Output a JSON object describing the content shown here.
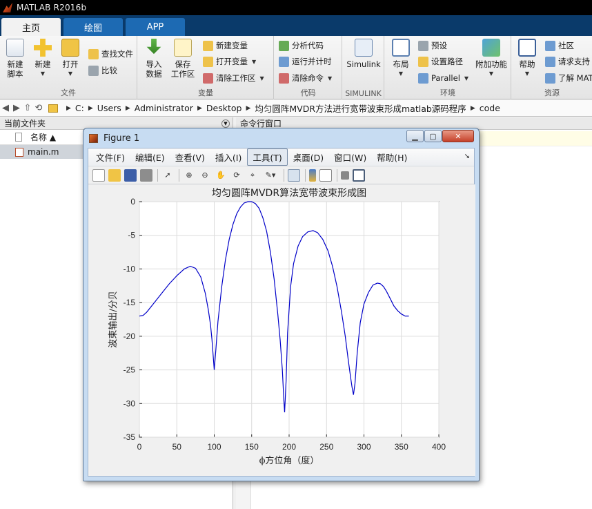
{
  "app": {
    "title": "MATLAB R2016b"
  },
  "ribbon_tabs": [
    "主页",
    "绘图",
    "APP"
  ],
  "ribbon": {
    "file": {
      "label": "文件",
      "new_script": "新建\n脚本",
      "new": "新建",
      "open": "打开",
      "find_files": "查找文件",
      "compare": "比较"
    },
    "variable": {
      "label": "变量",
      "import_data": "导入\n数据",
      "save_workspace": "保存\n工作区",
      "new_variable": "新建变量",
      "open_variable": "打开变量",
      "clear_workspace": "清除工作区"
    },
    "code": {
      "label": "代码",
      "analyze_code": "分析代码",
      "run_and_time": "运行并计时",
      "clear_commands": "清除命令"
    },
    "simulink": {
      "label": "SIMULINK",
      "simulink": "Simulink"
    },
    "environment": {
      "label": "环境",
      "layout": "布局",
      "preferences": "预设",
      "set_path": "设置路径",
      "parallel": "Parallel",
      "add_ons": "附加功能"
    },
    "resources": {
      "label": "资源",
      "help": "帮助",
      "community": "社区",
      "request_support": "请求支持",
      "learn_matlab": "了解 MAT"
    }
  },
  "address_bar": {
    "path": [
      "C:",
      "Users",
      "Administrator",
      "Desktop",
      "均匀圆阵MVDR方法进行宽带波束形成matlab源码程序",
      "code"
    ]
  },
  "current_folder": {
    "title": "当前文件夹",
    "column_name": "名称 ▲",
    "files": [
      "main.m"
    ]
  },
  "command_window": {
    "title": "命令行窗口"
  },
  "figure": {
    "window_title": "Figure 1",
    "menu": [
      "文件(F)",
      "编辑(E)",
      "查看(V)",
      "插入(I)",
      "工具(T)",
      "桌面(D)",
      "窗口(W)",
      "帮助(H)"
    ],
    "highlighted_menu": "工具(T)"
  },
  "chart_data": {
    "type": "line",
    "title": "均匀圆阵MVDR算法宽带波束形成图",
    "xlabel": "ϕ方位角（度）",
    "ylabel": "波束输出/分贝",
    "xlim": [
      0,
      400
    ],
    "ylim": [
      -35,
      0
    ],
    "xticks": [
      0,
      50,
      100,
      150,
      200,
      250,
      300,
      350,
      400
    ],
    "yticks": [
      0,
      -5,
      -10,
      -15,
      -20,
      -25,
      -30,
      -35
    ],
    "grid": true,
    "line_color": "#0000c8",
    "series": [
      {
        "x": [
          0,
          5,
          10,
          20,
          30,
          40,
          50,
          60,
          68,
          75,
          82,
          88,
          92,
          95,
          97,
          99,
          100,
          102,
          105,
          110,
          115,
          120,
          125,
          130,
          135,
          140,
          145,
          150,
          155,
          160,
          165,
          170,
          175,
          180,
          185,
          188,
          191,
          193,
          194,
          196,
          198,
          202,
          206,
          212,
          218,
          225,
          232,
          238,
          245,
          252,
          258,
          264,
          270,
          275,
          279,
          282,
          284,
          286,
          288,
          291,
          295,
          300,
          306,
          312,
          318,
          322,
          326,
          330,
          335,
          340,
          345,
          350,
          355,
          360
        ],
        "y": [
          -17.0,
          -16.9,
          -16.4,
          -15.0,
          -13.6,
          -12.2,
          -11.0,
          -10.0,
          -9.6,
          -9.9,
          -11.2,
          -13.6,
          -16.0,
          -18.3,
          -20.5,
          -23.5,
          -25.0,
          -22.2,
          -17.8,
          -12.6,
          -8.6,
          -5.6,
          -3.4,
          -1.8,
          -0.8,
          -0.2,
          0.0,
          0.0,
          -0.3,
          -1.0,
          -2.4,
          -4.4,
          -7.5,
          -11.5,
          -16.8,
          -20.5,
          -25.0,
          -29.5,
          -31.3,
          -26.5,
          -19.5,
          -12.6,
          -9.2,
          -6.6,
          -5.2,
          -4.5,
          -4.3,
          -4.6,
          -5.6,
          -7.3,
          -9.6,
          -12.6,
          -16.4,
          -20.0,
          -23.5,
          -26.0,
          -27.5,
          -28.7,
          -27.0,
          -22.5,
          -18.0,
          -15.2,
          -13.5,
          -12.4,
          -12.1,
          -12.2,
          -12.6,
          -13.3,
          -14.4,
          -15.5,
          -16.2,
          -16.7,
          -17.0,
          -17.0
        ]
      }
    ]
  }
}
